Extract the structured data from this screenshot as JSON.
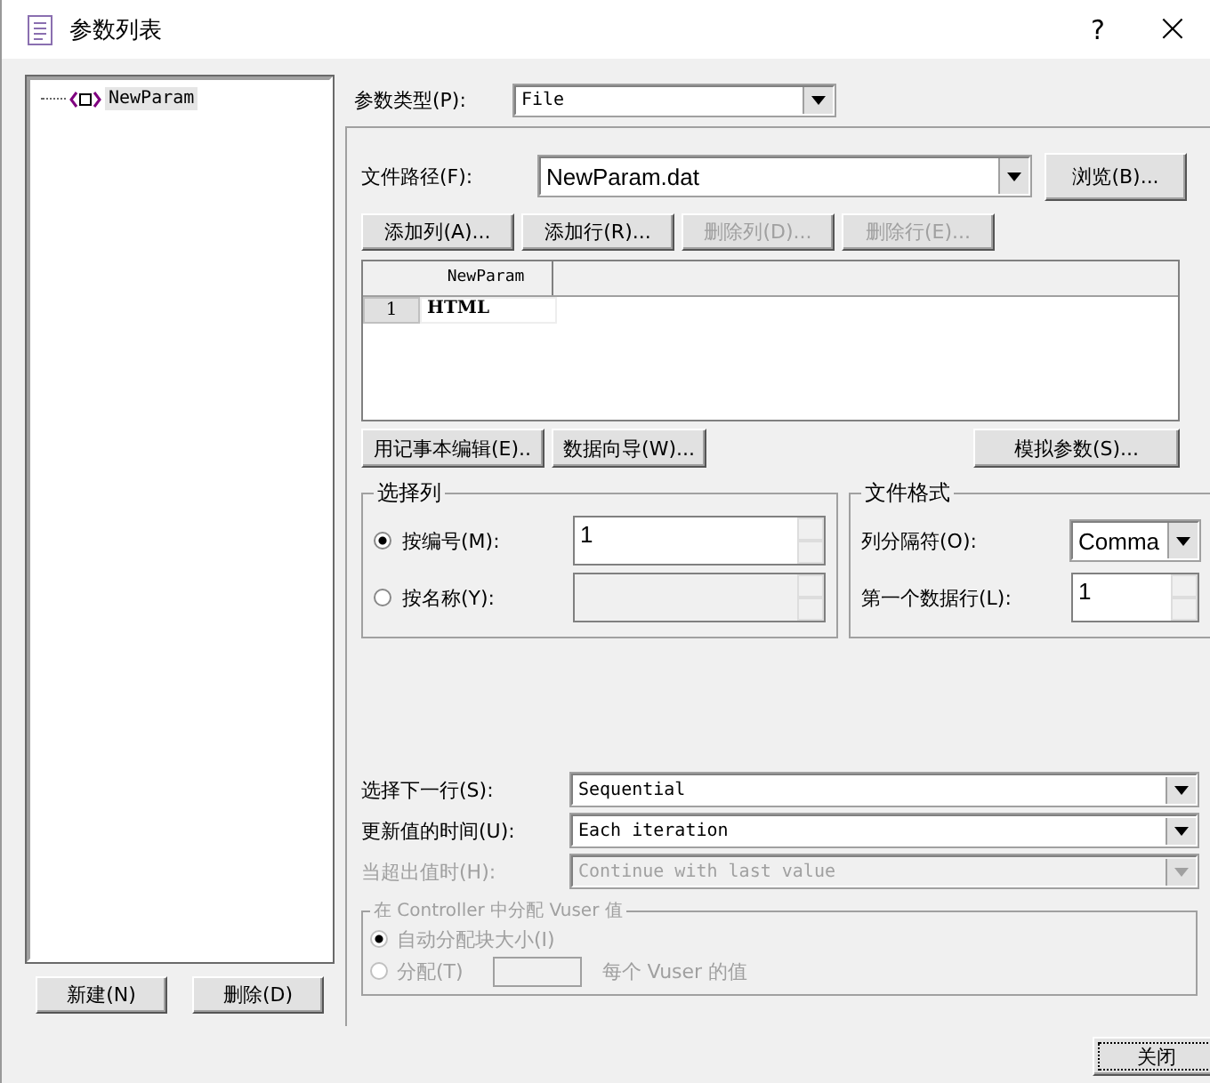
{
  "window": {
    "title": "参数列表",
    "help": "?",
    "close": "×"
  },
  "tree": {
    "items": [
      {
        "label": "NewParam",
        "selected": true
      }
    ]
  },
  "left_buttons": [
    {
      "label": "新建(N)",
      "disabled": false
    },
    {
      "label": "删除(D)",
      "disabled": false
    }
  ],
  "param_type": {
    "label": "参数类型(P):",
    "value": "File"
  },
  "file_path": {
    "label": "文件路径(F):",
    "value": "NewParam.dat",
    "browse": "浏览(B)..."
  },
  "table_buttons": [
    {
      "label": "添加列(A)...",
      "disabled": false
    },
    {
      "label": "添加行(R)...",
      "disabled": false
    },
    {
      "label": "删除列(D)...",
      "disabled": true
    },
    {
      "label": "删除行(E)...",
      "disabled": true
    }
  ],
  "table": {
    "columns": [
      "NewParam"
    ],
    "rows": [
      {
        "index": "1",
        "cells": [
          "HTML"
        ]
      }
    ]
  },
  "below_table_buttons": [
    {
      "label": "用记事本编辑(E)..",
      "disabled": false
    },
    {
      "label": "数据向导(W)...",
      "disabled": false
    },
    {
      "label": "模拟参数(S)...",
      "disabled": false
    }
  ],
  "select_column": {
    "title": "选择列",
    "options": [
      {
        "label": "按编号(M):",
        "selected": true,
        "value": "1",
        "disabled": false
      },
      {
        "label": "按名称(Y):",
        "selected": false,
        "disabled": true
      }
    ]
  },
  "file_format": {
    "title": "文件格式",
    "delimiter_label": "列分隔符(O):",
    "delimiter": "Comma",
    "first_row_label": "第一个数据行(L):",
    "first_row": "1"
  },
  "settings": [
    {
      "label": "选择下一行(S):",
      "value": "Sequential",
      "disabled": false
    },
    {
      "label": "更新值的时间(U):",
      "value": "Each iteration",
      "disabled": false
    },
    {
      "label": "当超出值时(H):",
      "value": "Continue with last value",
      "disabled": true
    }
  ],
  "vuser_group": {
    "title": "在 Controller 中分配 Vuser 值",
    "disabled": true,
    "options": [
      {
        "label": "自动分配块大小(I)",
        "selected": true
      },
      {
        "label": "分配(T)",
        "selected": false,
        "suffix": "每个 Vuser 的值"
      }
    ]
  },
  "close_button": "关闭"
}
